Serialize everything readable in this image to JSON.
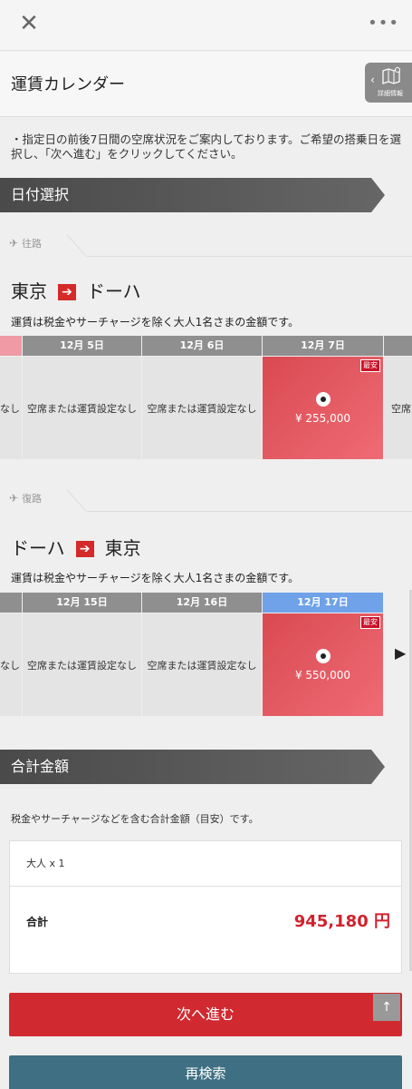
{
  "topbar": {
    "close_icon": "close-icon",
    "more_label": "•••"
  },
  "header": {
    "title": "運賃カレンダー",
    "detail_label": "詳細情報"
  },
  "notice": "・指定日の前後7日間の空席状況をご案内しております。ご希望の搭乗日を選択し、「次へ進む」をクリックしてください。",
  "date_section": {
    "title": "日付選択"
  },
  "outbound": {
    "tab_label": "往路",
    "from": "東京",
    "to": "ドーハ",
    "note": "運賃は税金やサーチャージを除く大人1名さまの金額です。",
    "days": [
      {
        "date": "",
        "status": "なし"
      },
      {
        "date": "12月 5日",
        "status": "空席または運賃設定なし"
      },
      {
        "date": "12月 6日",
        "status": "空席または運賃設定なし"
      },
      {
        "date": "12月 7日",
        "status": "",
        "price": "¥ 255,000",
        "badge": "最安",
        "selected": true
      },
      {
        "date": "",
        "status": "空席"
      }
    ]
  },
  "inbound": {
    "tab_label": "復路",
    "from": "ドーハ",
    "to": "東京",
    "note": "運賃は税金やサーチャージを除く大人1名さまの金額です。",
    "days": [
      {
        "date": "",
        "status": "なし"
      },
      {
        "date": "12月 15日",
        "status": "空席または運賃設定なし"
      },
      {
        "date": "12月 16日",
        "status": "空席または運賃設定なし"
      },
      {
        "date": "12月 17日",
        "status": "",
        "price": "¥ 550,000",
        "badge": "最安",
        "selected": true
      }
    ]
  },
  "total_section": {
    "title": "合計金額",
    "note": "税金やサーチャージなどを含む合計金額（目安）です。",
    "passengers": "大人 x 1",
    "total_label": "合計",
    "total_value": "945,180 円"
  },
  "buttons": {
    "next": "次へ進む",
    "top": "↑",
    "research": "再検索"
  },
  "colors": {
    "accent_red": "#d02a30",
    "research_blue": "#3e6f82",
    "selected_date_blue": "#6fa2e8"
  }
}
